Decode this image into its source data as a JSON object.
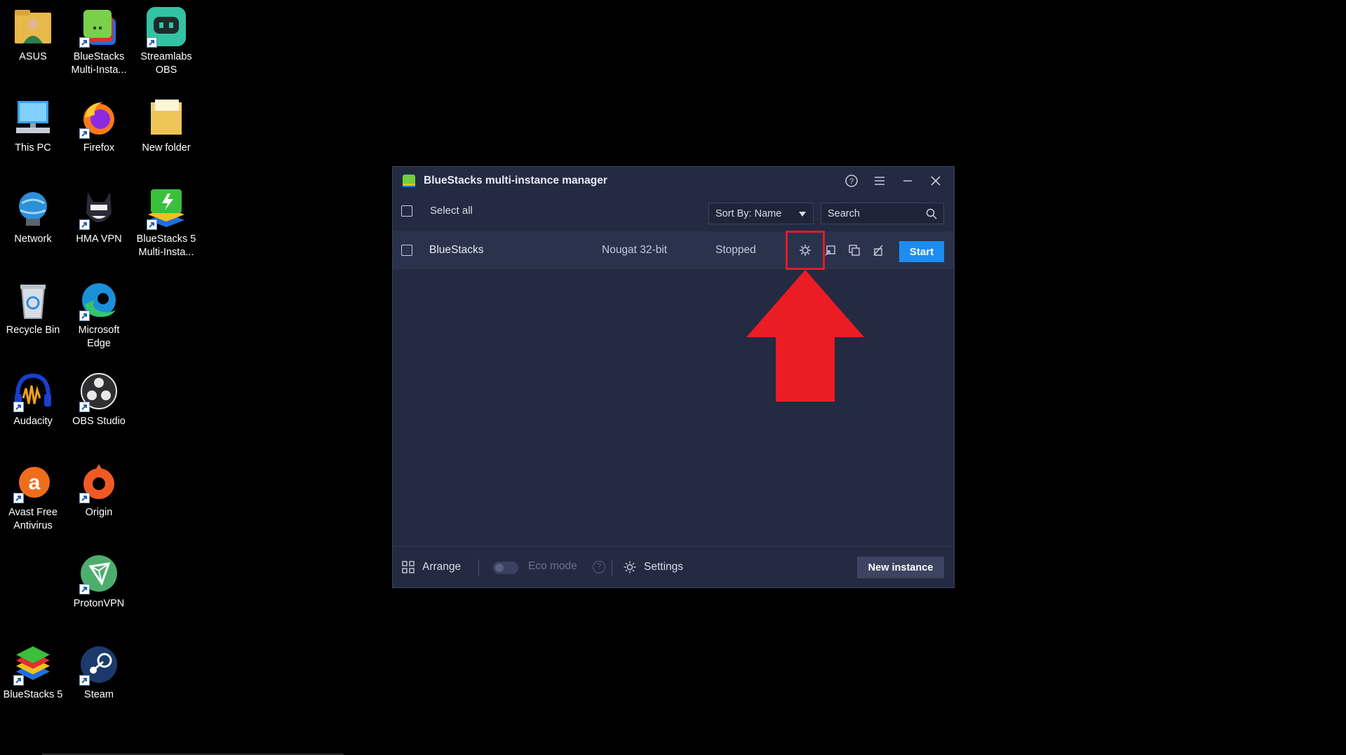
{
  "desktop": {
    "icons": [
      {
        "label": "ASUS",
        "icon": "user-folder-icon"
      },
      {
        "label": "BlueStacks Multi-Insta...",
        "icon": "bluestacks-multi-icon"
      },
      {
        "label": "Streamlabs OBS",
        "icon": "streamlabs-icon"
      },
      {
        "label": "This PC",
        "icon": "computer-icon"
      },
      {
        "label": "Firefox",
        "icon": "firefox-icon"
      },
      {
        "label": "New folder",
        "icon": "folder-icon"
      },
      {
        "label": "Network",
        "icon": "network-icon"
      },
      {
        "label": "HMA VPN",
        "icon": "hma-vpn-icon"
      },
      {
        "label": "BlueStacks 5 Multi-Insta...",
        "icon": "bluestacks5-multi-icon"
      },
      {
        "label": "Recycle Bin",
        "icon": "recycle-bin-icon"
      },
      {
        "label": "Microsoft Edge",
        "icon": "edge-icon"
      },
      {
        "label": "Audacity",
        "icon": "audacity-icon"
      },
      {
        "label": "OBS Studio",
        "icon": "obs-icon"
      },
      {
        "label": "Avast Free Antivirus",
        "icon": "avast-icon"
      },
      {
        "label": "Origin",
        "icon": "origin-icon"
      },
      {
        "label": "ProtonVPN",
        "icon": "protonvpn-icon"
      },
      {
        "label": "BlueStacks 5",
        "icon": "bluestacks5-icon"
      },
      {
        "label": "Steam",
        "icon": "steam-icon"
      }
    ]
  },
  "window": {
    "title": "BlueStacks multi-instance manager",
    "toolbar": {
      "select_all": "Select all",
      "sort_label": "Sort By: Name",
      "search_placeholder": "Search"
    },
    "instances": [
      {
        "name": "BlueStacks",
        "version": "Nougat 32-bit",
        "status": "Stopped",
        "action": "Start"
      }
    ],
    "footer": {
      "arrange": "Arrange",
      "eco_mode": "Eco mode",
      "eco_help": "?",
      "settings": "Settings",
      "new_instance": "New instance"
    }
  },
  "colors": {
    "window_bg": "#242a41",
    "row_bg": "#2b324c",
    "accent_blue": "#1e8cf0",
    "highlight_red": "#e01c28"
  }
}
